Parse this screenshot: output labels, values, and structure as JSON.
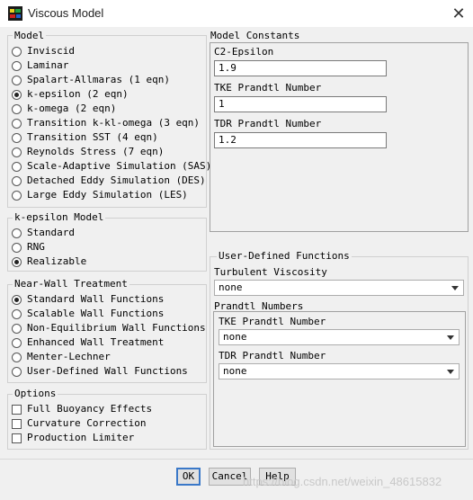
{
  "window": {
    "title": "Viscous Model",
    "close": "✕"
  },
  "model": {
    "label": "Model",
    "options": [
      "Inviscid",
      "Laminar",
      "Spalart-Allmaras (1 eqn)",
      "k-epsilon (2 eqn)",
      "k-omega (2 eqn)",
      "Transition k-kl-omega (3 eqn)",
      "Transition SST (4 eqn)",
      "Reynolds Stress (7 eqn)",
      "Scale-Adaptive Simulation (SAS)",
      "Detached Eddy Simulation (DES)",
      "Large Eddy Simulation (LES)"
    ],
    "selected_index": 3
  },
  "ke_model": {
    "label": "k-epsilon Model",
    "options": [
      "Standard",
      "RNG",
      "Realizable"
    ],
    "selected_index": 2
  },
  "near_wall": {
    "label": "Near-Wall Treatment",
    "options": [
      "Standard Wall Functions",
      "Scalable Wall Functions",
      "Non-Equilibrium Wall Functions",
      "Enhanced Wall Treatment",
      "Menter-Lechner",
      "User-Defined Wall Functions"
    ],
    "selected_index": 0
  },
  "options": {
    "label": "Options",
    "items": [
      "Full Buoyancy Effects",
      "Curvature Correction",
      "Production Limiter"
    ]
  },
  "constants": {
    "label": "Model Constants",
    "c2_label": "C2-Epsilon",
    "c2_value": "1.9",
    "tke_label": "TKE Prandtl Number",
    "tke_value": "1",
    "tdr_label": "TDR Prandtl Number",
    "tdr_value": "1.2"
  },
  "udf": {
    "label": "User-Defined Functions",
    "turb_visc_label": "Turbulent Viscosity",
    "turb_visc_value": "none",
    "prandtl_label": "Prandtl Numbers",
    "tke_label": "TKE Prandtl Number",
    "tke_value": "none",
    "tdr_label": "TDR Prandtl Number",
    "tdr_value": "none"
  },
  "buttons": {
    "ok": "OK",
    "cancel": "Cancel",
    "help": "Help"
  },
  "watermark": "https://blog.csdn.net/weixin_48615832"
}
